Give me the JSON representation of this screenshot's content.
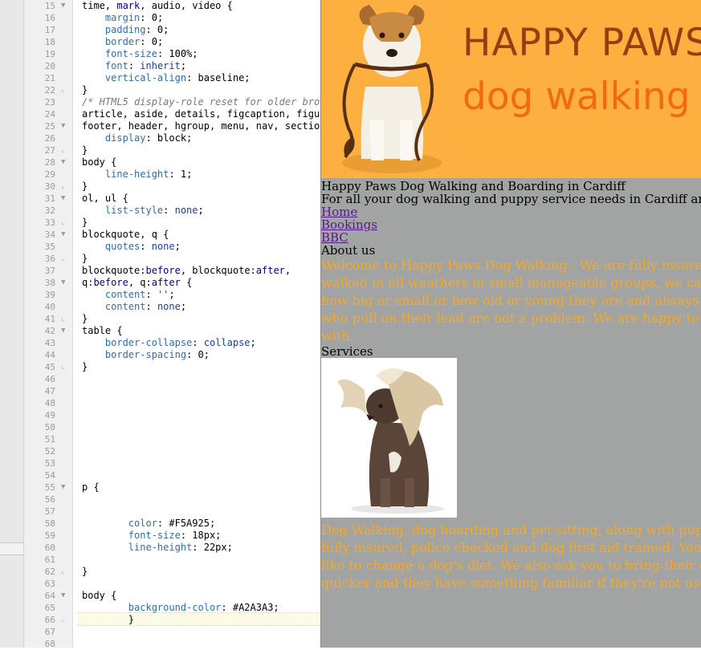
{
  "editor": {
    "lines": [
      {
        "n": "15",
        "fold": "▼",
        "code": [
          {
            "t": "time, "
          },
          {
            "t": "mark",
            "c": "kw"
          },
          {
            "t": ", audio, video {"
          }
        ]
      },
      {
        "n": "16",
        "fold": "",
        "code": [
          {
            "t": "    "
          },
          {
            "t": "margin",
            "c": "pr"
          },
          {
            "t": ": 0;"
          }
        ]
      },
      {
        "n": "17",
        "fold": "",
        "code": [
          {
            "t": "    "
          },
          {
            "t": "padding",
            "c": "pr"
          },
          {
            "t": ": 0;"
          }
        ]
      },
      {
        "n": "18",
        "fold": "",
        "code": [
          {
            "t": "    "
          },
          {
            "t": "border",
            "c": "pr"
          },
          {
            "t": ": 0;"
          }
        ]
      },
      {
        "n": "19",
        "fold": "",
        "code": [
          {
            "t": "    "
          },
          {
            "t": "font-size",
            "c": "pr"
          },
          {
            "t": ": 100%;"
          }
        ]
      },
      {
        "n": "20",
        "fold": "",
        "code": [
          {
            "t": "    "
          },
          {
            "t": "font",
            "c": "pr"
          },
          {
            "t": ": "
          },
          {
            "t": "inherit",
            "c": "vl"
          },
          {
            "t": ";"
          }
        ]
      },
      {
        "n": "21",
        "fold": "",
        "code": [
          {
            "t": "    "
          },
          {
            "t": "vertical-align",
            "c": "pr"
          },
          {
            "t": ": baseline;"
          }
        ]
      },
      {
        "n": "22",
        "fold": "⌞",
        "code": [
          {
            "t": "}"
          }
        ]
      },
      {
        "n": "23",
        "fold": "",
        "code": [
          {
            "t": "/* HTML5 display-role reset for older brow",
            "c": "cm"
          }
        ]
      },
      {
        "n": "24",
        "fold": "",
        "code": [
          {
            "t": "article, aside, details, figcaption, figu"
          }
        ]
      },
      {
        "n": "25",
        "fold": "▼",
        "code": [
          {
            "t": "footer, header, hgroup, menu, nav, sectio"
          }
        ]
      },
      {
        "n": "26",
        "fold": "",
        "code": [
          {
            "t": "    "
          },
          {
            "t": "display",
            "c": "pr"
          },
          {
            "t": ": block;"
          }
        ]
      },
      {
        "n": "27",
        "fold": "⌞",
        "code": [
          {
            "t": "}"
          }
        ]
      },
      {
        "n": "28",
        "fold": "▼",
        "code": [
          {
            "t": "body {"
          }
        ]
      },
      {
        "n": "29",
        "fold": "",
        "code": [
          {
            "t": "    "
          },
          {
            "t": "line-height",
            "c": "pr"
          },
          {
            "t": ": 1;"
          }
        ]
      },
      {
        "n": "30",
        "fold": "⌞",
        "code": [
          {
            "t": "}"
          }
        ]
      },
      {
        "n": "31",
        "fold": "▼",
        "code": [
          {
            "t": "ol, ul {"
          }
        ]
      },
      {
        "n": "32",
        "fold": "",
        "code": [
          {
            "t": "    "
          },
          {
            "t": "list-style",
            "c": "pr"
          },
          {
            "t": ": "
          },
          {
            "t": "none",
            "c": "vl"
          },
          {
            "t": ";"
          }
        ]
      },
      {
        "n": "33",
        "fold": "⌞",
        "code": [
          {
            "t": "}"
          }
        ]
      },
      {
        "n": "34",
        "fold": "▼",
        "code": [
          {
            "t": "blockquote, q {"
          }
        ]
      },
      {
        "n": "35",
        "fold": "",
        "code": [
          {
            "t": "    "
          },
          {
            "t": "quotes",
            "c": "pr"
          },
          {
            "t": ": "
          },
          {
            "t": "none",
            "c": "vl"
          },
          {
            "t": ";"
          }
        ]
      },
      {
        "n": "36",
        "fold": "⌞",
        "code": [
          {
            "t": "}"
          }
        ]
      },
      {
        "n": "37",
        "fold": "",
        "code": [
          {
            "t": "blockquote:"
          },
          {
            "t": "before",
            "c": "kw"
          },
          {
            "t": ", blockquote:"
          },
          {
            "t": "after",
            "c": "kw"
          },
          {
            "t": ","
          }
        ]
      },
      {
        "n": "38",
        "fold": "▼",
        "code": [
          {
            "t": "q:"
          },
          {
            "t": "before",
            "c": "kw"
          },
          {
            "t": ", q:"
          },
          {
            "t": "after",
            "c": "kw"
          },
          {
            "t": " {"
          }
        ]
      },
      {
        "n": "39",
        "fold": "",
        "code": [
          {
            "t": "    "
          },
          {
            "t": "content",
            "c": "pr"
          },
          {
            "t": ": "
          },
          {
            "t": "''",
            "c": "st"
          },
          {
            "t": ";"
          }
        ]
      },
      {
        "n": "40",
        "fold": "",
        "code": [
          {
            "t": "    "
          },
          {
            "t": "content",
            "c": "pr"
          },
          {
            "t": ": "
          },
          {
            "t": "none",
            "c": "vl"
          },
          {
            "t": ";"
          }
        ]
      },
      {
        "n": "41",
        "fold": "⌞",
        "code": [
          {
            "t": "}"
          }
        ]
      },
      {
        "n": "42",
        "fold": "▼",
        "code": [
          {
            "t": "table {"
          }
        ]
      },
      {
        "n": "43",
        "fold": "",
        "code": [
          {
            "t": "    "
          },
          {
            "t": "border-collapse",
            "c": "pr"
          },
          {
            "t": ": "
          },
          {
            "t": "collapse",
            "c": "vl"
          },
          {
            "t": ";"
          }
        ]
      },
      {
        "n": "44",
        "fold": "",
        "code": [
          {
            "t": "    "
          },
          {
            "t": "border-spacing",
            "c": "pr"
          },
          {
            "t": ": 0;"
          }
        ]
      },
      {
        "n": "45",
        "fold": "⌞",
        "code": [
          {
            "t": "}"
          }
        ]
      },
      {
        "n": "46",
        "fold": "",
        "code": []
      },
      {
        "n": "47",
        "fold": "",
        "code": []
      },
      {
        "n": "48",
        "fold": "",
        "code": []
      },
      {
        "n": "49",
        "fold": "",
        "code": []
      },
      {
        "n": "50",
        "fold": "",
        "code": []
      },
      {
        "n": "51",
        "fold": "",
        "code": []
      },
      {
        "n": "52",
        "fold": "",
        "code": []
      },
      {
        "n": "53",
        "fold": "",
        "code": []
      },
      {
        "n": "54",
        "fold": "",
        "code": []
      },
      {
        "n": "55",
        "fold": "▼",
        "code": [
          {
            "t": "p {"
          }
        ]
      },
      {
        "n": "56",
        "fold": "",
        "code": []
      },
      {
        "n": "57",
        "fold": "",
        "code": []
      },
      {
        "n": "58",
        "fold": "",
        "code": [
          {
            "t": "        "
          },
          {
            "t": "color",
            "c": "pr"
          },
          {
            "t": ": #F5A925;"
          }
        ]
      },
      {
        "n": "59",
        "fold": "",
        "code": [
          {
            "t": "        "
          },
          {
            "t": "font-size",
            "c": "pr"
          },
          {
            "t": ": 18px;"
          }
        ]
      },
      {
        "n": "60",
        "fold": "",
        "code": [
          {
            "t": "        "
          },
          {
            "t": "line-height",
            "c": "pr"
          },
          {
            "t": ": 22px;"
          }
        ]
      },
      {
        "n": "61",
        "fold": "",
        "code": []
      },
      {
        "n": "62",
        "fold": "⌞",
        "code": [
          {
            "t": "}"
          }
        ]
      },
      {
        "n": "63",
        "fold": "",
        "code": []
      },
      {
        "n": "64",
        "fold": "▼",
        "code": [
          {
            "t": "body {"
          }
        ]
      },
      {
        "n": "65",
        "fold": "",
        "code": [
          {
            "t": "        "
          },
          {
            "t": "background-color",
            "c": "pr"
          },
          {
            "t": ": #A2A3A3;"
          }
        ]
      },
      {
        "n": "66",
        "fold": "⌞",
        "code": [
          {
            "t": "        }"
          }
        ]
      },
      {
        "n": "67",
        "fold": "",
        "code": []
      },
      {
        "n": "68",
        "fold": "",
        "code": []
      }
    ],
    "active_line": "66"
  },
  "preview": {
    "banner": {
      "line1": "HAPPY PAWS",
      "line2": "dog walking"
    },
    "heading": "Happy Paws Dog Walking and Boarding in Cardiff",
    "tagline": "For all your dog walking and puppy service needs in Cardiff and surround",
    "nav": [
      "Home",
      "Bookings",
      "BBC"
    ],
    "about_heading": "About us",
    "about_lines": [
      "Welcome to Happy Paws Dog Walking . We are fully insured, pol",
      "walked in all weathers in small manageable groups, we can also w",
      "how big or small or how old or young they are and always put the",
      "who pull on their lead are not a problem. We are happy to keep yo",
      "with."
    ],
    "services_heading": "Services",
    "services_lines": [
      "Dog Walking, dog boarding and pet sitting, along with puppy serv",
      "fully insured, police checked and dog first aid trained. You will ne",
      "like to change a dog's diet. We also ask you to bring their own bed",
      "quicker and they have something familiar if they're not used to be"
    ]
  },
  "colors": {
    "paragraph_text": "#F5A925",
    "page_background": "#A2A3A3",
    "banner": "#FDB040",
    "brand_dark": "#9A3B10",
    "brand_light": "#F06A10"
  }
}
